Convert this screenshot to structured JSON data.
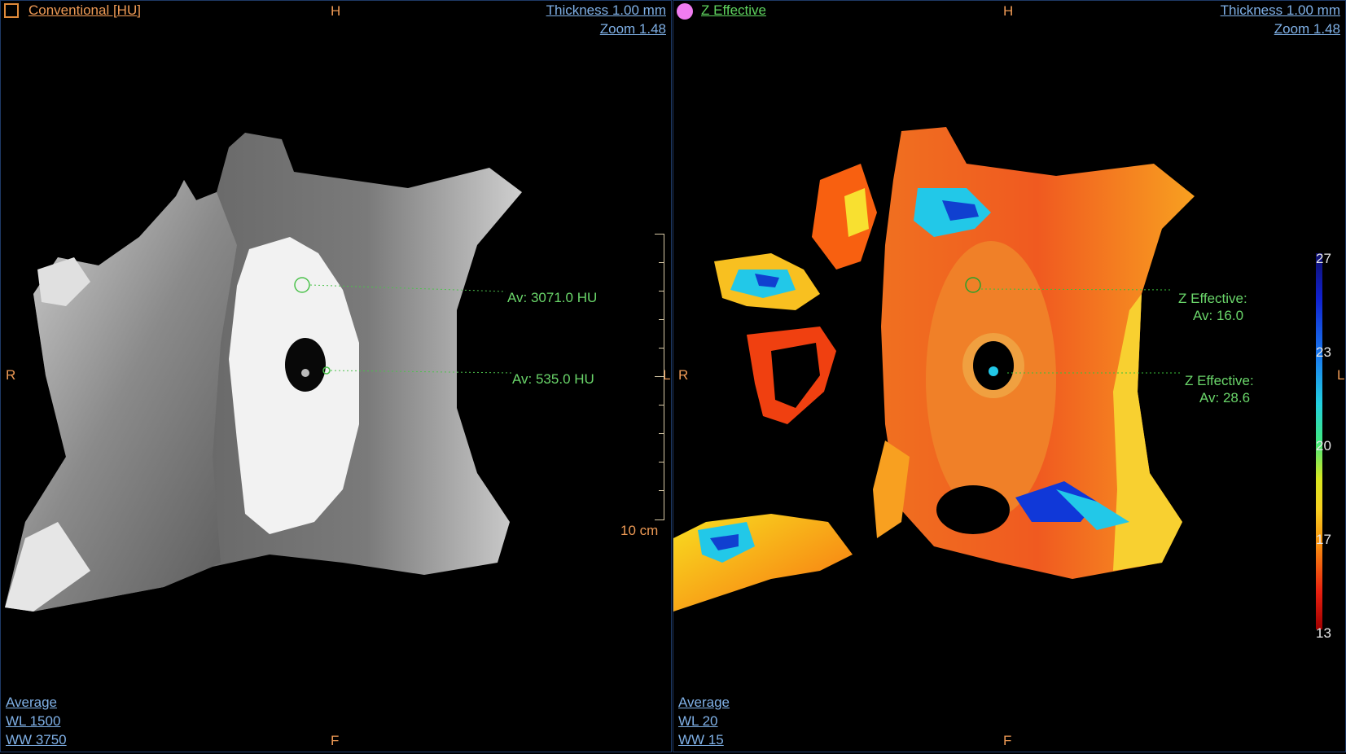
{
  "left": {
    "series_label": "Conventional [HU]",
    "thickness": "Thickness 1.00 mm",
    "zoom": "Zoom 1.48",
    "orient_top": "H",
    "orient_bottom": "F",
    "orient_left": "R",
    "orient_right": "L",
    "scale_label": "10 cm",
    "measurements": [
      {
        "text": "Av:  3071.0 HU"
      },
      {
        "text": "Av:  535.0 HU"
      }
    ],
    "mode": "Average",
    "wl": "WL   1500",
    "ww": "WW  3750",
    "colors": {
      "swatch": "#e08a3a",
      "measure": "#5fd35f"
    }
  },
  "right": {
    "series_label": "Z Effective",
    "thickness": "Thickness 1.00 mm",
    "zoom": "Zoom 1.48",
    "orient_top": "H",
    "orient_bottom": "F",
    "orient_left": "R",
    "orient_right": "L",
    "measurements": [
      {
        "title": "Z Effective:",
        "value": "Av:  16.0"
      },
      {
        "title": "Z Effective:",
        "value": "Av:  28.6"
      }
    ],
    "colorbar_ticks": [
      "27",
      "23",
      "20",
      "17",
      "13"
    ],
    "mode": "Average",
    "wl": "WL    20",
    "ww": "WW    15",
    "colors": {
      "swatch": "#f07cf0",
      "measure": "#5fd35f"
    }
  }
}
